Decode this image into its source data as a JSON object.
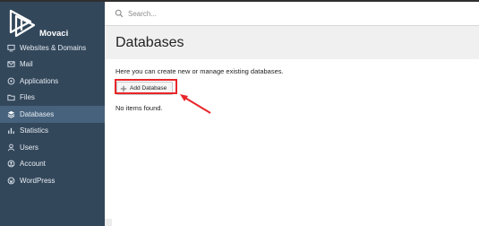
{
  "app": {
    "brand": "Movaci"
  },
  "search": {
    "placeholder": "Search..."
  },
  "sidebar": {
    "items": [
      {
        "label": "Websites & Domains",
        "icon": "monitor-icon"
      },
      {
        "label": "Mail",
        "icon": "mail-icon"
      },
      {
        "label": "Applications",
        "icon": "apps-icon"
      },
      {
        "label": "Files",
        "icon": "folder-icon"
      },
      {
        "label": "Databases",
        "icon": "database-icon",
        "active": true
      },
      {
        "label": "Statistics",
        "icon": "chart-icon"
      },
      {
        "label": "Users",
        "icon": "user-icon"
      },
      {
        "label": "Account",
        "icon": "account-icon"
      },
      {
        "label": "WordPress",
        "icon": "wordpress-icon"
      }
    ]
  },
  "main": {
    "title": "Databases",
    "description": "Here you can create new or manage existing databases.",
    "add_button_label": "Add Database",
    "empty_text": "No items found."
  },
  "colors": {
    "sidebar_bg": "#33475b",
    "sidebar_active": "#46627d",
    "highlight_red": "#e8262a"
  }
}
